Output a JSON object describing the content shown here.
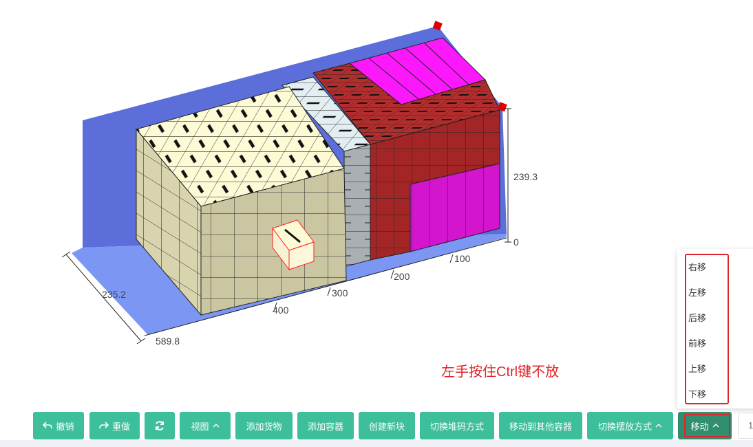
{
  "axes": {
    "height_max": "239.3",
    "height_min": "0",
    "length_ticks": [
      "100",
      "200",
      "300",
      "400"
    ],
    "length_total": "589.8",
    "width_total": "235.2"
  },
  "hint_text": "左手按住Ctrl键不放",
  "move_menu": {
    "items": [
      "右移",
      "左移",
      "后移",
      "前移",
      "上移",
      "下移"
    ]
  },
  "toolbar": {
    "undo": "撤销",
    "redo": "重做",
    "view": "视图",
    "add_cargo": "添加货物",
    "add_container": "添加容器",
    "create_block": "创建新块",
    "switch_stacking": "切换堆码方式",
    "move_to_other": "移动到其他容器",
    "switch_placement": "切换摆放方式",
    "move": "移动",
    "page_value": "1"
  },
  "colors": {
    "container_wall": "#5b6ed9",
    "container_floor": "#7b96f3",
    "cargo_cream": "#fdfbd6",
    "cargo_cream_side": "#cdc9a0",
    "cargo_red": "#a52828",
    "cargo_magenta": "#e014d9",
    "cargo_gray": "#a7adb1",
    "accent_green": "#3cbf9a",
    "highlight_red": "#e0242b"
  }
}
